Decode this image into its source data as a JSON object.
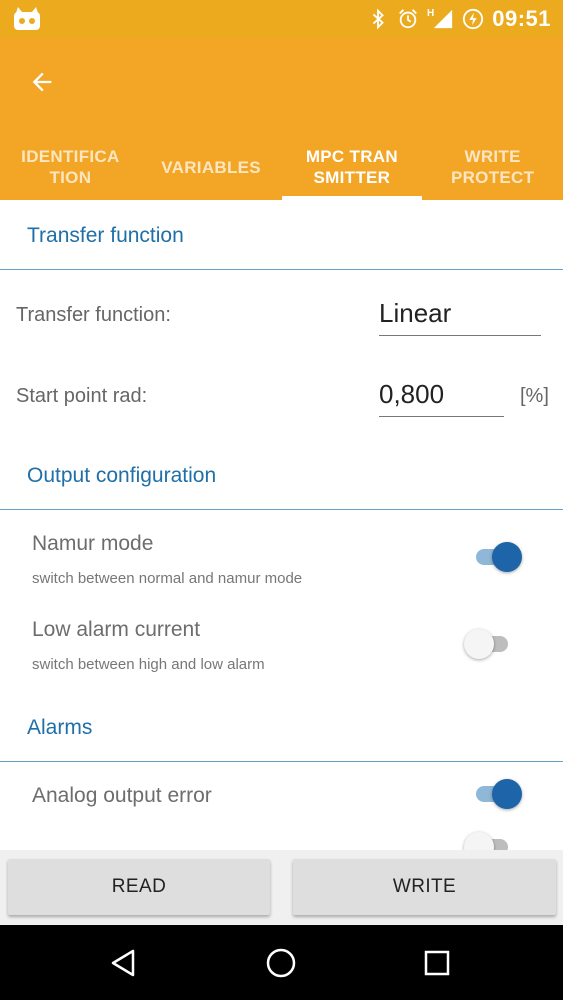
{
  "status_bar": {
    "time": "09:51",
    "network_label": "H",
    "icons": [
      "app-notification-icon",
      "bluetooth-icon",
      "alarm-icon",
      "signal-icon",
      "battery-charging-icon"
    ]
  },
  "app_bar": {
    "back_icon": "arrow-back-icon",
    "tabs": [
      {
        "label": "IDENTIFICA TION",
        "active": false
      },
      {
        "label": "VARIABLES",
        "active": false
      },
      {
        "label": "MPC TRAN SMITTER",
        "active": true
      },
      {
        "label": "WRITE PROTECT",
        "active": false
      }
    ]
  },
  "sections": {
    "transfer": {
      "title": "Transfer function",
      "function_label": "Transfer function:",
      "function_value": "Linear",
      "start_label": "Start point rad:",
      "start_value": "0,800",
      "start_unit": "[%]"
    },
    "output": {
      "title": "Output configuration",
      "namur_title": "Namur mode",
      "namur_sub": "switch between normal and namur mode",
      "namur_on": true,
      "low_alarm_title": "Low alarm current",
      "low_alarm_sub": "switch between high and low alarm",
      "low_alarm_on": false
    },
    "alarms": {
      "title": "Alarms",
      "analog_error_title": "Analog output error",
      "analog_error_on": true
    }
  },
  "buttons": {
    "read": "READ",
    "write": "WRITE"
  },
  "nav_bar": {
    "icons": [
      "back-triangle-icon",
      "home-circle-icon",
      "recents-square-icon"
    ]
  },
  "colors": {
    "status_bar": "#ecaa1f",
    "app_bar": "#f3a626",
    "accent_blue": "#1f6fa8",
    "switch_on": "#1d64a8"
  }
}
